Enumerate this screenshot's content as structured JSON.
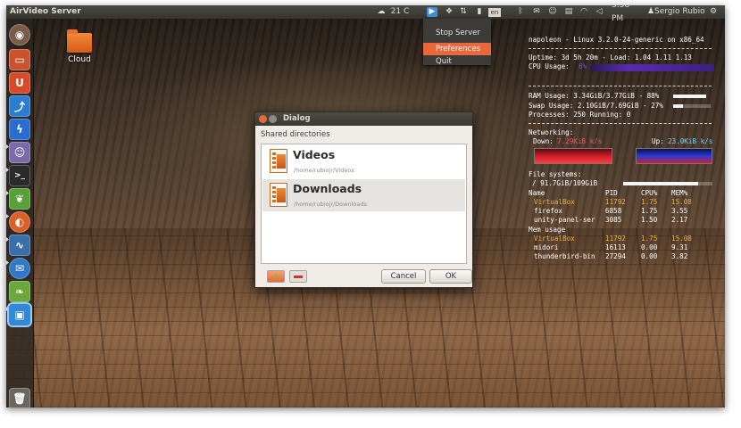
{
  "panel": {
    "app_title": "AirVideo Server",
    "weather": "21 C",
    "keyboard": "en",
    "time": "3:58 PM",
    "user": "Sergio Rubio"
  },
  "desktop": {
    "icon_label": "Cloud"
  },
  "menu": {
    "items": [
      "Stop Server",
      "Preferences",
      "Quit"
    ],
    "selected": "Preferences"
  },
  "dialog": {
    "title": "Dialog",
    "section_label": "Shared directories",
    "rows": [
      {
        "title": "Videos",
        "path": "/home/rubiojr/Videos"
      },
      {
        "title": "Downloads",
        "path": "/home/rubiojr/Downloads"
      }
    ],
    "cancel_label": "Cancel",
    "ok_label": "OK"
  },
  "conky": {
    "header": "napoleon - Linux 3.2.0-24-generic on x86_64",
    "uptime": "Uptime: 3d 5h 20m - Load: 1.04 1.11 1.13",
    "cpu_label": "CPU Usage: ",
    "cpu_value": "6%",
    "ram": "RAM Usage: 3.34GiB/3.77GiB - 88%",
    "ram_fraction": 0.88,
    "swap": "Swap Usage: 2.10GiB/7.69GiB - 27%",
    "swap_fraction": 0.27,
    "processes": "Processes: 250  Running: 0",
    "networking_label": "Networking:",
    "down_label": "Down:",
    "down_value": "7.29KiB k/s",
    "up_label": "Up:",
    "up_value": "23.0KiB k/s",
    "fs_label": "File systems:",
    "fs_value": "/ 91.7GiB/109GiB",
    "fs_fraction": 0.84,
    "cols": [
      "Name",
      "PID",
      "CPU%",
      "MEM%"
    ],
    "cpu_procs": [
      [
        "VirtualBox",
        "11792",
        "1.75",
        "15.08"
      ],
      [
        "firefox",
        "6858",
        "1.75",
        "3.55"
      ],
      [
        "unity-panel-ser",
        "3085",
        "1.50",
        "2.17"
      ]
    ],
    "mem_label": "Mem usage",
    "mem_procs": [
      [
        "VirtualBox",
        "11792",
        "1.75",
        "15.08"
      ],
      [
        "midori",
        "16113",
        "0.00",
        "9.31"
      ],
      [
        "thunderbird-bin",
        "27294",
        "0.00",
        "3.82"
      ]
    ]
  },
  "colors": {
    "accent": "#e9683a",
    "highlight": "#f0b040",
    "net_down": "#cc1f2a",
    "net_up": "#2a3ad8",
    "cpu_graph": "#5a2ab0"
  }
}
